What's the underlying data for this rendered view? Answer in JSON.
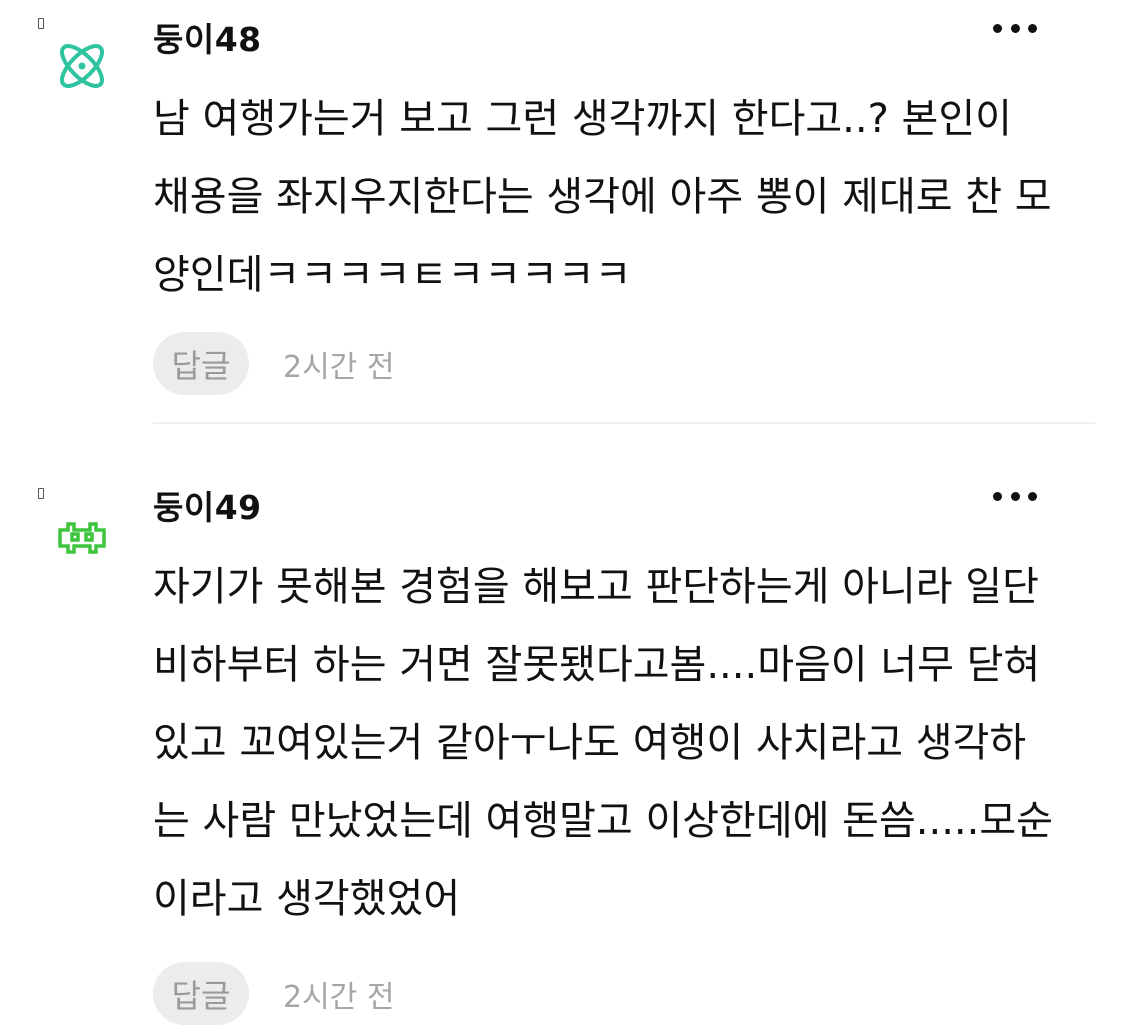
{
  "comments": [
    {
      "nickname": "둥이48",
      "avatar_icon": "atom-icon",
      "avatar_color": "#2ec4a0",
      "text": "남 여행가는거 보고 그런 생각까지 한다고..? 본인이\n채용을 좌지우지한다는 생각에 아주 뽕이 제대로 찬 모\n양인데ㅋㅋㅋㅋㅌㅋㅋㅋㅋㅋ",
      "reply_label": "답글",
      "time": "2시간 전"
    },
    {
      "nickname": "둥이49",
      "avatar_icon": "space-invader-icon",
      "avatar_color": "#3ec43e",
      "text": "자기가 못해본 경험을 해보고 판단하는게 아니라 일단\n비하부터 하는 거면 잘못됐다고봄....마음이 너무 닫혀\n있고 꼬여있는거 같아ㅜ나도 여행이 사치라고 생각하\n는 사람 만났었는데 여행말고 이상한데에 돈씀.....모순\n이라고 생각했었어",
      "reply_label": "답글",
      "time": "2시간 전"
    }
  ],
  "colors": {
    "text": "#111111",
    "muted": "#a6a6a6",
    "reply_bg": "#ececec",
    "divider": "#f0f0f0"
  }
}
